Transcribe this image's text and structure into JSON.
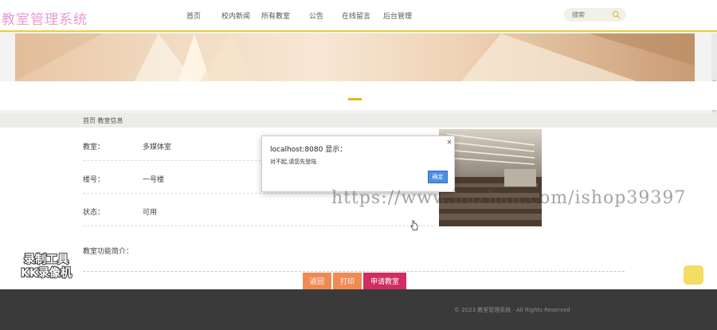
{
  "header": {
    "logo": "教室管理系统",
    "nav": [
      "首页",
      "校内新闻",
      "所有教室",
      "公告",
      "在线留言",
      "后台管理"
    ],
    "search": {
      "placeholder": "搜索"
    }
  },
  "breadcrumb": "首页 教室信息",
  "detail": {
    "rows": [
      {
        "label": "教室：",
        "value": "多媒体室"
      },
      {
        "label": "楼号：",
        "value": "一号楼"
      },
      {
        "label": "状态：",
        "value": "可用"
      }
    ],
    "description_label": "教室功能简介："
  },
  "buttons": {
    "back": "返回",
    "print": "打印",
    "apply": "申请教室"
  },
  "dialog": {
    "title": "localhost:8080 显示：",
    "message": "对不起,请您先登陆",
    "ok": "确定",
    "close": "×"
  },
  "watermarks": {
    "url": "https://www.huzhan.com/ishop39397",
    "recorder": [
      "录制工具",
      "KK录像机"
    ]
  },
  "footer": {
    "text": "© 2023 教室管理系统 · All Rights Reserved"
  },
  "colors": {
    "accent": "#e6cf3c",
    "logo": "#e89ad6",
    "button_orange": "#f08a55",
    "button_red": "#cf2e60",
    "dialog_ok": "#4a8fe3"
  }
}
